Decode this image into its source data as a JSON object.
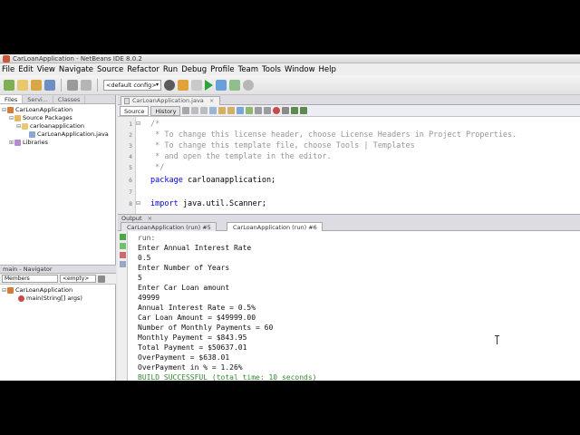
{
  "window": {
    "title": "CarLoanApplication - NetBeans IDE 8.0.2"
  },
  "menu": [
    "File",
    "Edit",
    "View",
    "Navigate",
    "Source",
    "Refactor",
    "Run",
    "Debug",
    "Profile",
    "Team",
    "Tools",
    "Window",
    "Help"
  ],
  "toolbar": {
    "config_value": "<default config>"
  },
  "projects_panel": {
    "tabs": [
      "Files",
      "Servi...",
      "Classes"
    ],
    "tree": {
      "project": "CarLoanApplication",
      "source_packages": "Source Packages",
      "package": "carloanapplication",
      "file": "CarLoanApplication.java",
      "libraries": "Libraries"
    }
  },
  "navigator": {
    "title": "main - Navigator",
    "members_label": "Members",
    "filter_value": "<empty>",
    "class_name": "CarLoanApplication",
    "method": "main(String[] args)"
  },
  "editor": {
    "tab_label": "CarLoanApplication.java",
    "source_button": "Source",
    "history_button": "History",
    "lines": [
      {
        "num": "1",
        "text": "/*",
        "kind": "comment"
      },
      {
        "num": "2",
        "text": " * To change this license header, choose License Headers in Project Properties.",
        "kind": "comment"
      },
      {
        "num": "3",
        "text": " * To change this template file, choose Tools | Templates",
        "kind": "comment"
      },
      {
        "num": "4",
        "text": " * and open the template in the editor.",
        "kind": "comment"
      },
      {
        "num": "5",
        "text": " */",
        "kind": "comment"
      },
      {
        "num": "6",
        "kw": "package",
        "rest": " carloanapplication;"
      },
      {
        "num": "7",
        "text": "",
        "kind": "plain"
      },
      {
        "num": "8",
        "kw": "import",
        "rest": " java.util.Scanner;"
      }
    ]
  },
  "output": {
    "title": "Output",
    "tabs": [
      "CarLoanApplication (run) #5",
      "CarLoanApplication (run) #6"
    ],
    "lines": [
      "run:",
      "Enter Annual Interest Rate",
      "0.5",
      "Enter Number of Years",
      "5",
      "Enter Car Loan amount",
      "49999",
      "Annual Interest Rate = 0.5%",
      "Car Loan Amount = $49999.00",
      "Number of Monthly Payments = 60",
      "Monthly Payment = $843.95",
      "Total Payment = $50637.01",
      "OverPayment = $638.01",
      "OverPayment in % = 1.26%",
      "BUILD SUCCESSFUL (total time: 10 seconds)"
    ]
  },
  "colors": {
    "keyword": "#0000e6",
    "comment": "#969696",
    "success": "#2f8b2f"
  }
}
